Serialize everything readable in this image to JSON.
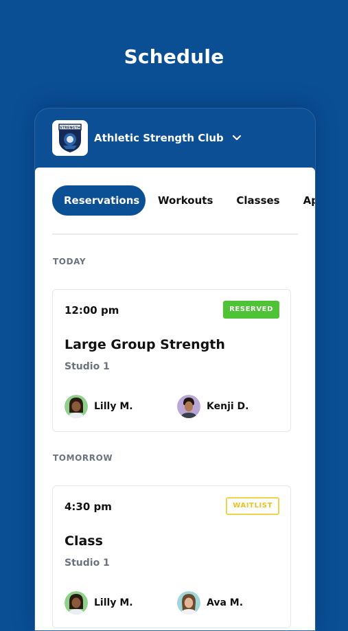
{
  "page": {
    "title": "Schedule"
  },
  "club": {
    "name": "Athletic Strength Club",
    "logo_text": "STRENGTH"
  },
  "tabs": [
    {
      "label": "Reservations",
      "active": true
    },
    {
      "label": "Workouts",
      "active": false
    },
    {
      "label": "Classes",
      "active": false
    },
    {
      "label": "Ap",
      "active": false
    }
  ],
  "sections": [
    {
      "label": "TODAY",
      "card": {
        "time": "12:00 pm",
        "badge": "RESERVED",
        "title": "Large Group Strength",
        "studio": "Studio 1",
        "attendees": [
          {
            "name": "Lilly M."
          },
          {
            "name": "Kenji D."
          }
        ]
      }
    },
    {
      "label": "TOMORROW",
      "card": {
        "time": "4:30 pm",
        "badge": "WAITLIST",
        "title": "Class",
        "studio": "Studio 1",
        "attendees": [
          {
            "name": "Lilly M."
          },
          {
            "name": "Ava M."
          }
        ]
      }
    }
  ],
  "colors": {
    "background": "#0a4f94",
    "accent": "#0b4f94",
    "reserved": "#4fc336",
    "waitlist": "#e8c21f"
  }
}
